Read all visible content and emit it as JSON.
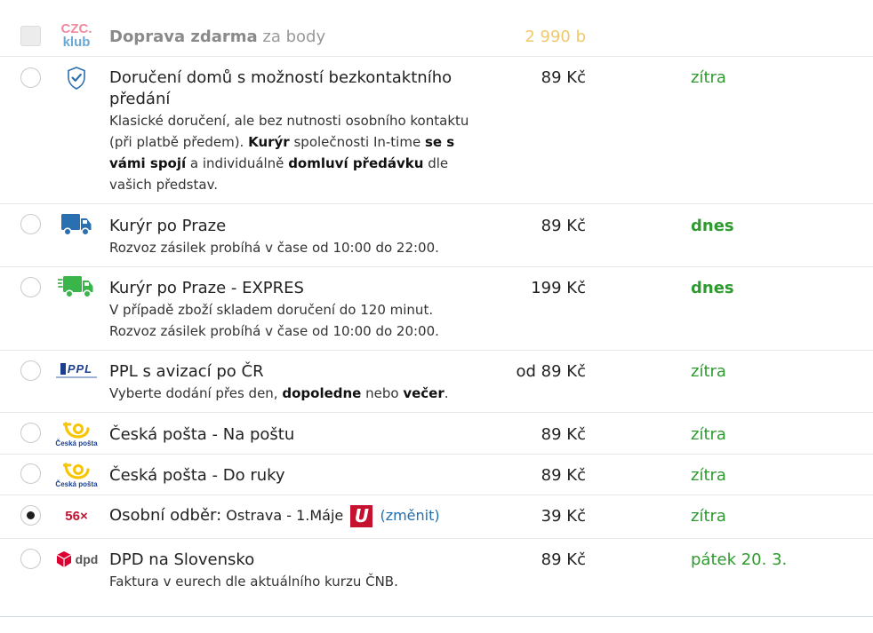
{
  "club": {
    "logo_top": "CZC.",
    "logo_bottom": "klub",
    "title_bold": "Doprava zdarma",
    "title_rest": "za body",
    "price": "2 990 b"
  },
  "options": [
    {
      "id": "contactless",
      "icon": "shield-check-icon",
      "title": "Doručení domů s možností bezkontaktního předání",
      "desc_parts": [
        "Klasické doručení, ale bez nutnosti osobního kontaktu (při platbě předem). ",
        "Kurýr",
        " společnosti In-time ",
        "se s vámi spojí",
        " a individuálně ",
        "domluví předávku",
        " dle vašich představ."
      ],
      "price": "89 Kč",
      "eta": "zítra"
    },
    {
      "id": "courier-prague",
      "icon": "truck-icon",
      "title": "Kurýr po Praze",
      "desc": "Rozvoz zásilek probíhá v čase od 10:00 do 22:00.",
      "price": "89 Kč",
      "eta": "dnes"
    },
    {
      "id": "courier-express",
      "icon": "fast-truck-icon",
      "title": "Kurýr po Praze - EXPRES",
      "desc": "V případě zboží skladem doručení do 120 minut. Rozvoz zásilek probíhá v čase od 10:00 do 20:00.",
      "price": "199 Kč",
      "eta": "dnes"
    },
    {
      "id": "ppl",
      "icon": "ppl-logo",
      "logo_text": "PPL",
      "title": "PPL s avizací po ČR",
      "desc_parts": [
        "Vyberte dodání přes den, ",
        "dopoledne",
        " nebo ",
        "večer",
        "."
      ],
      "price": "od 89 Kč",
      "eta": "zítra"
    },
    {
      "id": "posta-napostu",
      "icon": "ceska-posta-logo",
      "logo_text": "Česká pošta",
      "title": "Česká pošta - Na poštu",
      "price": "89 Kč",
      "eta": "zítra"
    },
    {
      "id": "posta-doruky",
      "icon": "ceska-posta-logo",
      "logo_text": "Česká pošta",
      "title": "Česká pošta - Do ruky",
      "price": "89 Kč",
      "eta": "zítra"
    },
    {
      "id": "pickup",
      "icon": "56-logo",
      "logo_text": "56×",
      "title": "Osobní odběr:",
      "branch": "Ostrava - 1.Máje",
      "badge": "U",
      "change": "(změnit)",
      "price": "39 Kč",
      "eta": "zítra",
      "selected": true
    },
    {
      "id": "dpd-sk",
      "icon": "dpd-logo",
      "logo_text": "dpd",
      "title": "DPD na Slovensko",
      "desc": "Faktura v eurech dle aktuálního kurzu ČNB.",
      "price": "89 Kč",
      "eta": "pátek 20. 3."
    }
  ],
  "colors": {
    "eta_green": "#2f9a2f",
    "club_price": "#f0c96b",
    "link_blue": "#1f6fb3",
    "truck_blue": "#2a6fb0",
    "truck_green": "#3ab54a",
    "posta_yellow": "#f7c600",
    "posta_blue": "#1b3f8f",
    "badge_red": "#c41230",
    "dpd_red": "#dc0032"
  }
}
